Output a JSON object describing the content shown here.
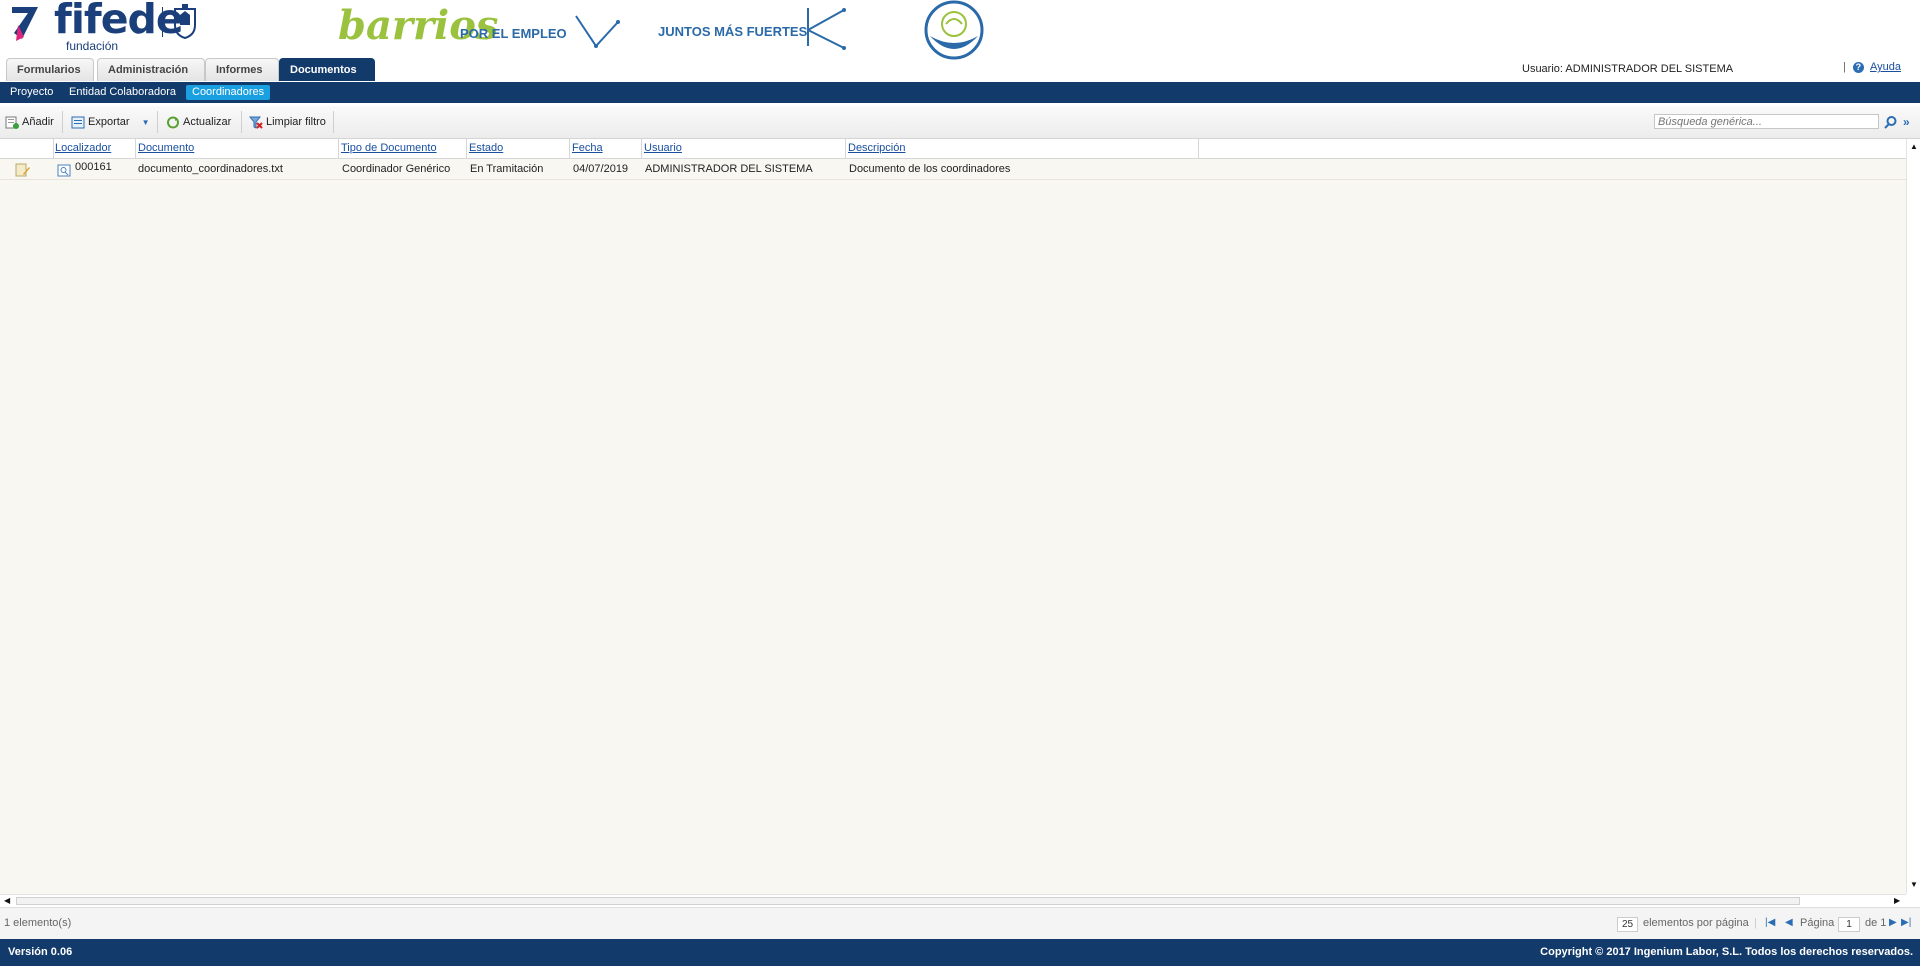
{
  "header": {
    "brand": "fifede",
    "brand_sub": "fundación",
    "barrios_script": "barrios",
    "barrios_tag": "POR EL EMPLEO",
    "juntos": "JUNTOS MÁS FUERTES",
    "user_label": "Usuario: ADMINISTRADOR DEL SISTEMA",
    "help_label": "Ayuda"
  },
  "tabs": [
    {
      "label": "Formularios",
      "active": false
    },
    {
      "label": "Administración",
      "active": false
    },
    {
      "label": "Informes",
      "active": false
    },
    {
      "label": "Documentos",
      "active": true
    }
  ],
  "subnav": [
    {
      "label": "Proyecto",
      "active": false
    },
    {
      "label": "Entidad Colaboradora",
      "active": false
    },
    {
      "label": "Coordinadores",
      "active": true
    }
  ],
  "toolbar": {
    "add": "Añadir",
    "export": "Exportar",
    "refresh": "Actualizar",
    "clear_filter": "Limpiar filtro",
    "search_placeholder": "Búsqueda genérica..."
  },
  "grid": {
    "columns": [
      "Localizador",
      "Documento",
      "Tipo de Documento",
      "Estado",
      "Fecha",
      "Usuario",
      "Descripción"
    ],
    "rows": [
      {
        "localizador": "000161",
        "documento": "documento_coordinadores.txt",
        "tipo": "Coordinador Genérico",
        "estado": "En Tramitación",
        "fecha": "04/07/2019",
        "usuario": "ADMINISTRADOR DEL SISTEMA",
        "descripcion": "Documento de los coordinadores"
      }
    ]
  },
  "pager": {
    "count": "1 elemento(s)",
    "per_page_value": "25",
    "per_page_label": "elementos por página",
    "page_label": "Página",
    "page_value": "1",
    "of_label": "de 1"
  },
  "footer": {
    "version": "Versión 0.06",
    "copyright": "Copyright © 2017 Ingenium Labor, S.L. Todos los derechos reservados."
  },
  "colors": {
    "navy": "#123a6b",
    "active_subnav": "#1aa0e0",
    "barrios_green": "#9bc23f",
    "link_blue": "#1a4fa0"
  }
}
